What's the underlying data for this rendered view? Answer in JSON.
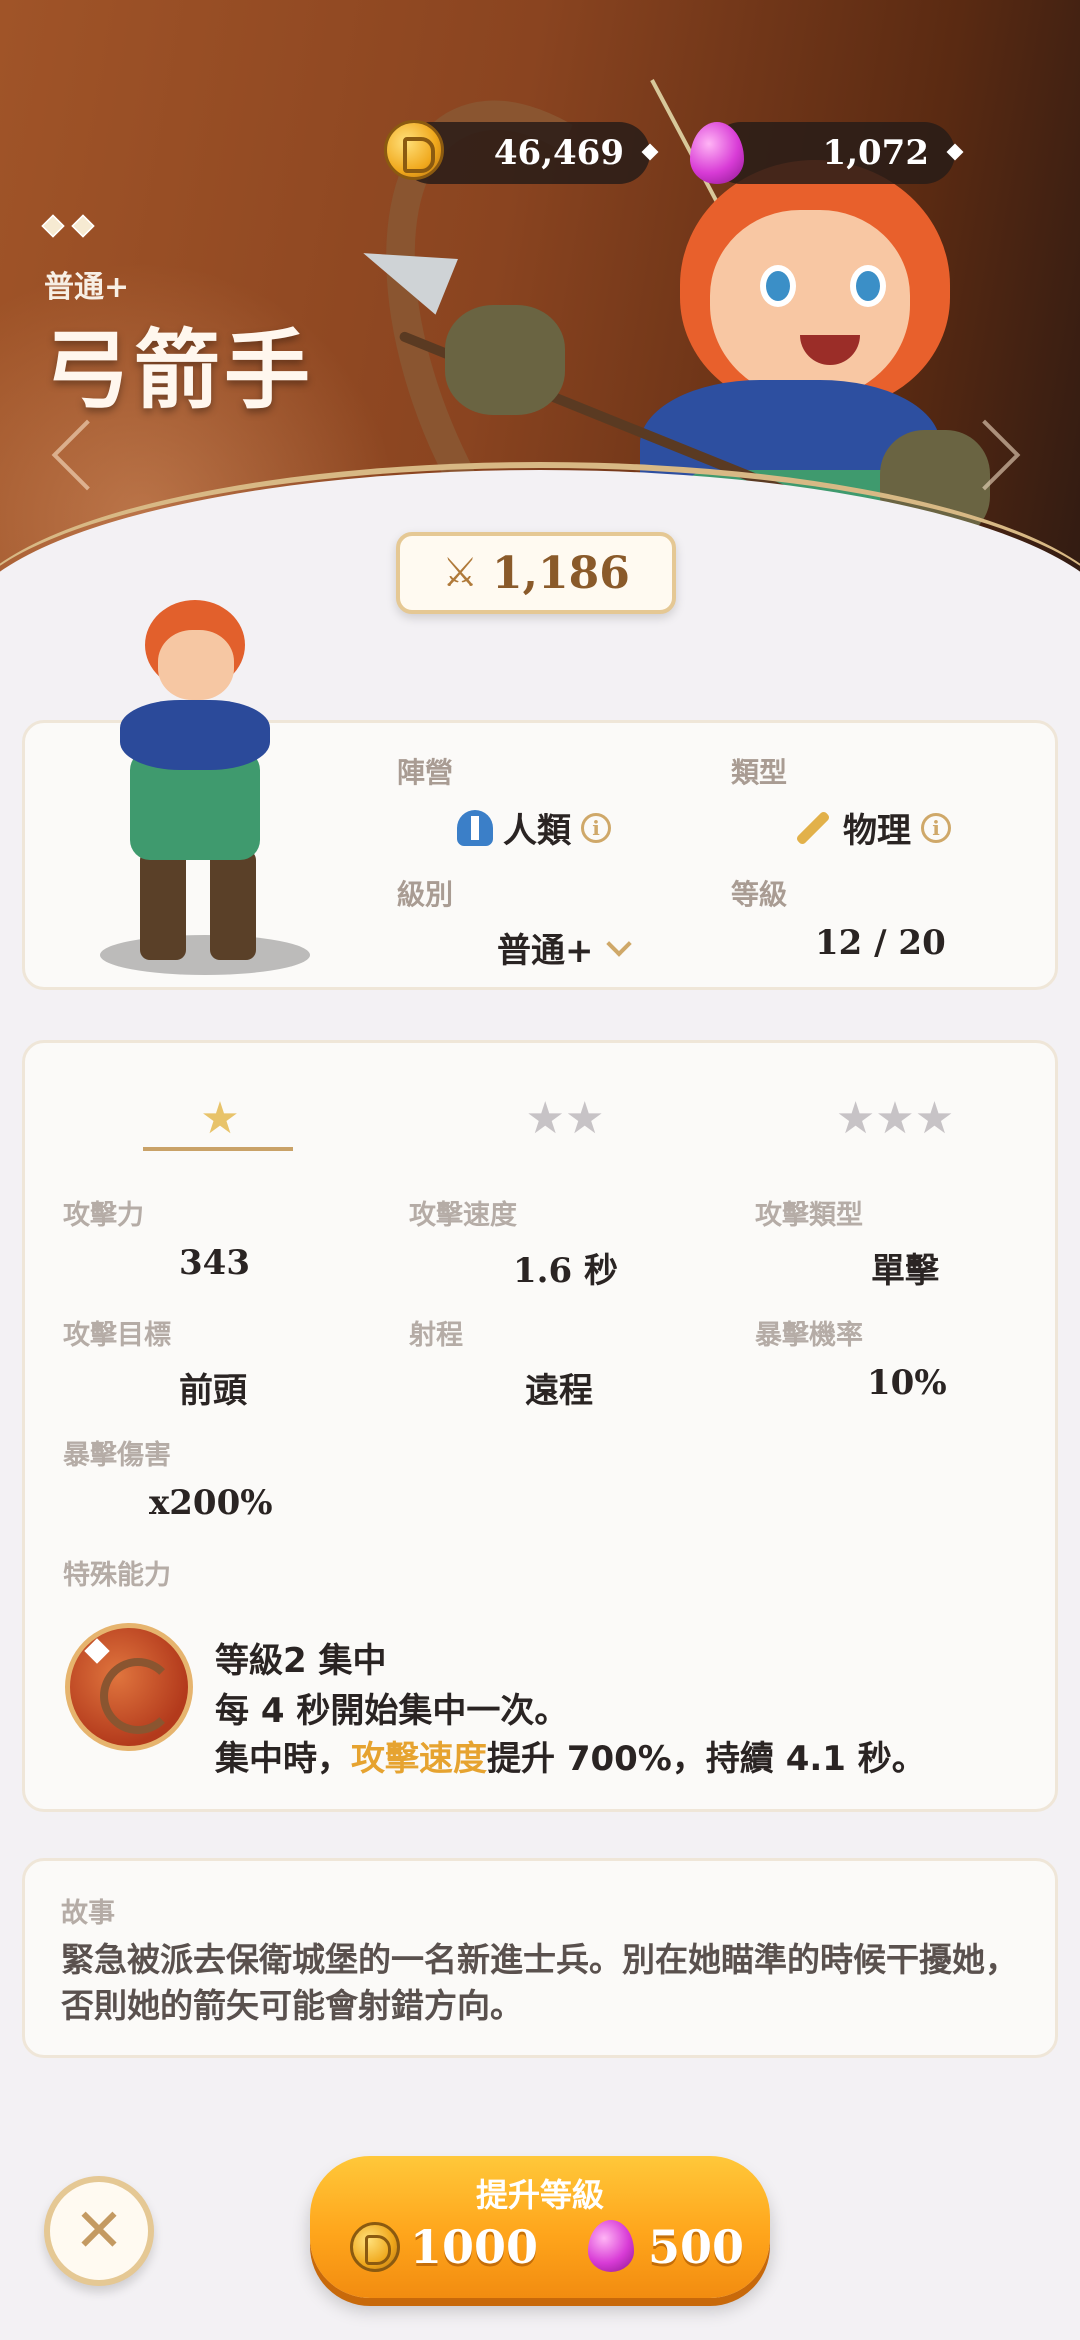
{
  "currency": {
    "gold": "46,469",
    "gems": "1,072"
  },
  "hero": {
    "rarity": "普通+",
    "name": "弓箭手",
    "power": "1,186"
  },
  "info": {
    "faction_label": "陣營",
    "faction_value": "人類",
    "type_label": "類型",
    "type_value": "物理",
    "grade_label": "級別",
    "grade_value": "普通+",
    "level_label": "等級",
    "level_value": "12 / 20"
  },
  "stats": {
    "tabs": [
      "★",
      "★★",
      "★★★"
    ],
    "items": [
      {
        "label": "攻擊力",
        "value": "343"
      },
      {
        "label": "攻擊速度",
        "value": "1.6 秒"
      },
      {
        "label": "攻擊類型",
        "value": "單擊"
      },
      {
        "label": "攻擊目標",
        "value": "前頭"
      },
      {
        "label": "射程",
        "value": "遠程"
      },
      {
        "label": "暴擊機率",
        "value": "10%"
      },
      {
        "label": "暴擊傷害",
        "value": "x200%"
      }
    ],
    "special_label": "特殊能力",
    "skill": {
      "title": "等級2 集中",
      "line1": "每 4 秒開始集中一次。",
      "line2_pre": "集中時，",
      "line2_hl": "攻擊速度",
      "line2_post": "提升 700%，持續 4.1 秒。"
    }
  },
  "story": {
    "label": "故事",
    "text": "緊急被派去保衛城堡的一名新進士兵。別在她瞄準的時候干擾她，否則她的箭矢可能會射錯方向。"
  },
  "upgrade": {
    "label": "提升等級",
    "gold_cost": "1000",
    "gem_cost": "500"
  },
  "icons": {
    "close": "close-icon",
    "info": "info-icon",
    "chevron": "chevron-down-icon"
  }
}
